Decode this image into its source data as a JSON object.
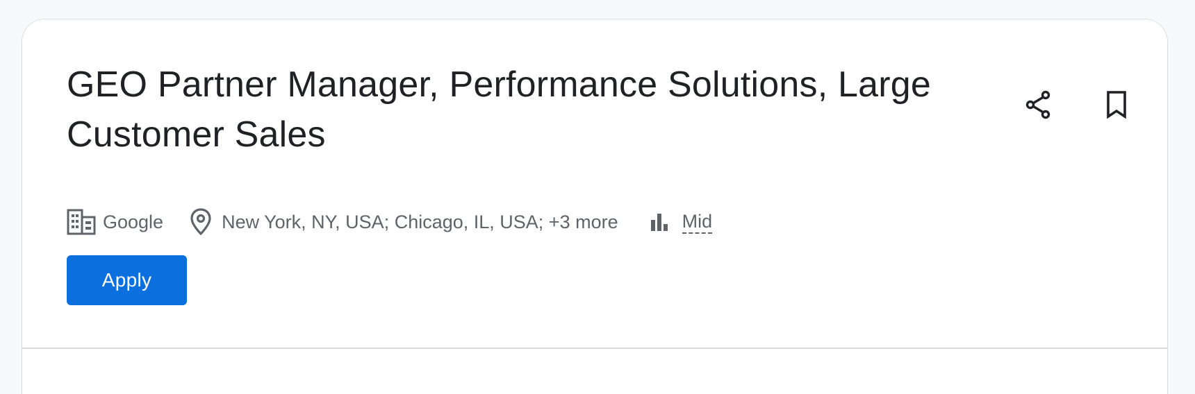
{
  "job": {
    "title": "GEO Partner Manager, Performance Solutions, Large Customer Sales",
    "company": "Google",
    "locations": "New York, NY, USA; Chicago, IL, USA; +3 more",
    "level": "Mid"
  },
  "actions": {
    "apply_label": "Apply",
    "share_icon": "share-icon",
    "bookmark_icon": "bookmark-icon"
  },
  "icons": {
    "company": "building-icon",
    "location": "location-pin-icon",
    "level": "bar-chart-icon"
  },
  "colors": {
    "accent": "#0b6fde",
    "text_primary": "#202124",
    "text_secondary": "#5f6368",
    "background": "#f8f9fa",
    "card": "#ffffff"
  }
}
